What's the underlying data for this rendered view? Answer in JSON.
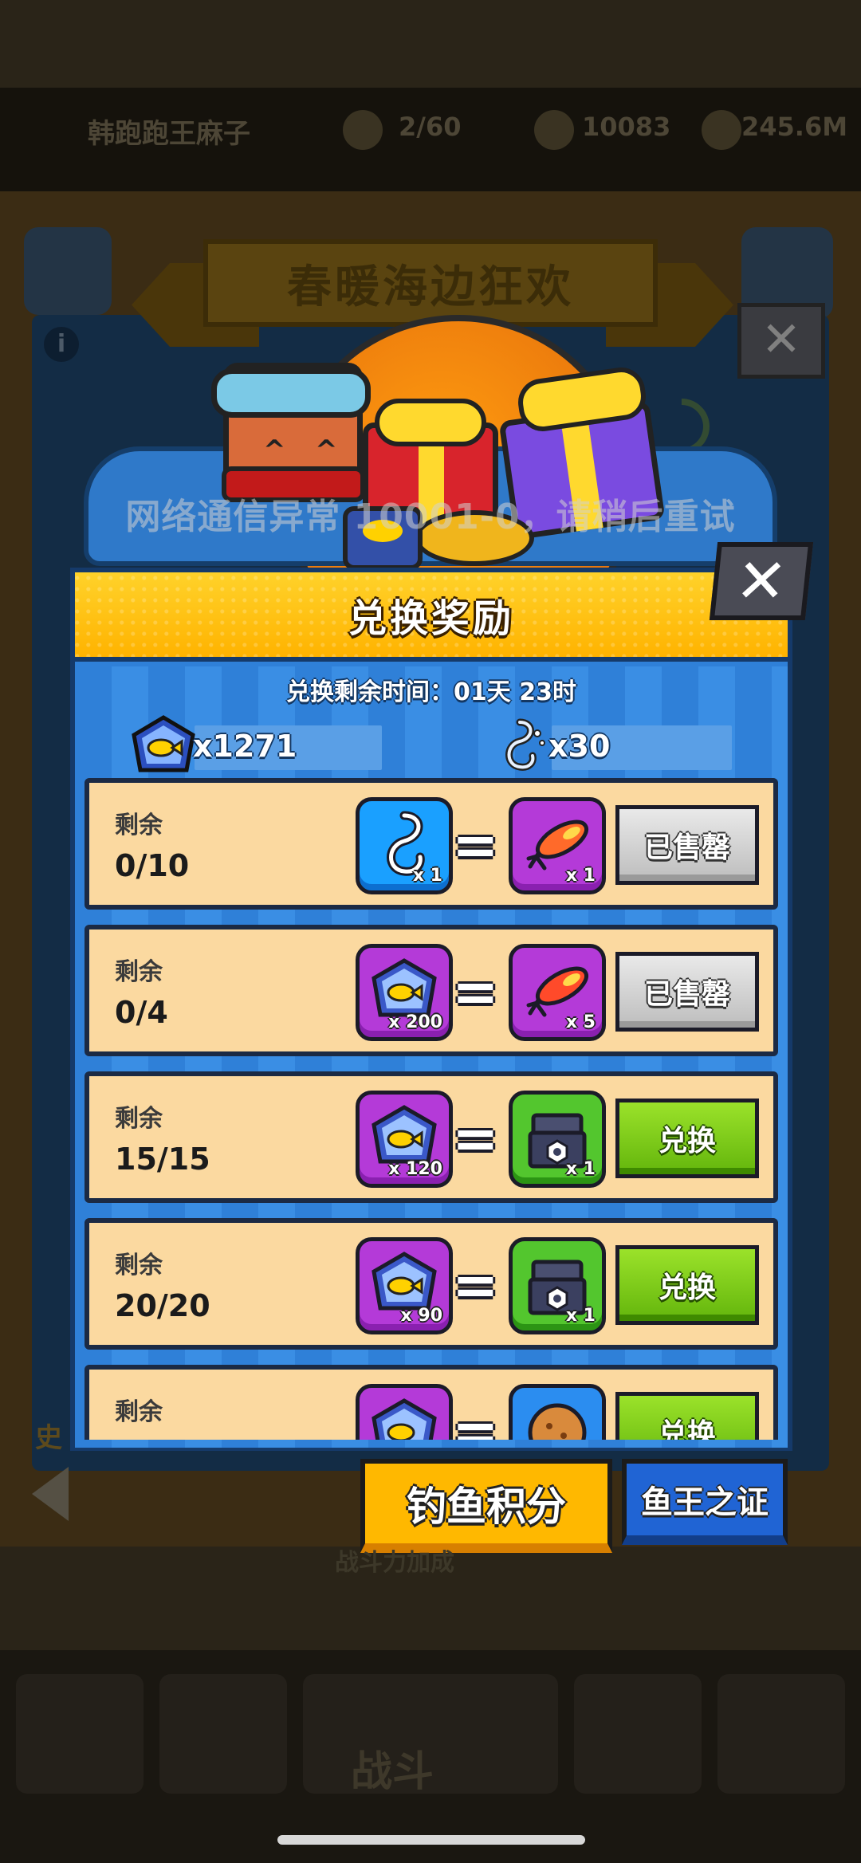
{
  "background": {
    "player_name": "韩跑跑王麻子",
    "stats": [
      "2/60",
      "10083",
      "245.6M"
    ],
    "side_text": "史",
    "under_tabs_text": "战斗力加成",
    "bottom_nav_battle": "战斗"
  },
  "event": {
    "title": "春暖海边狂欢",
    "close_glyph": "✕",
    "info_glyph": "i"
  },
  "toast": "网络通信异常 10001-0，请稍后重试",
  "modal": {
    "title": "兑换奖励",
    "close_glyph": "✕",
    "timer_label": "兑换剩余时间：01天 23时",
    "currencies": [
      {
        "icon": "fish-badge-icon",
        "value": "x1271"
      },
      {
        "icon": "fishing-hook-icon",
        "value": "x30"
      }
    ],
    "rows": [
      {
        "label": "剩余",
        "count": "0/10",
        "cost_icon": "fishing-hook-icon",
        "cost_tile": "blue",
        "cost_qty": "x 1",
        "reward_icon": "fishing-lure-icon",
        "reward_tile": "purple",
        "reward_qty": "x 1",
        "action": "已售罄",
        "sold_out": true
      },
      {
        "label": "剩余",
        "count": "0/4",
        "cost_icon": "fish-badge-icon",
        "cost_tile": "purple",
        "cost_qty": "x 200",
        "reward_icon": "fishing-lure-icon",
        "reward_tile": "purple",
        "reward_qty": "x 5",
        "action": "已售罄",
        "sold_out": true
      },
      {
        "label": "剩余",
        "count": "15/15",
        "cost_icon": "fish-badge-icon",
        "cost_tile": "purple",
        "cost_qty": "x 120",
        "reward_icon": "chest-icon",
        "reward_tile": "green",
        "reward_qty": "x 1",
        "action": "兑换",
        "sold_out": false
      },
      {
        "label": "剩余",
        "count": "20/20",
        "cost_icon": "fish-badge-icon",
        "cost_tile": "purple",
        "cost_qty": "x 90",
        "reward_icon": "chest-icon",
        "reward_tile": "green",
        "reward_qty": "x 1",
        "action": "兑换",
        "sold_out": false
      },
      {
        "label": "剩余",
        "count": "",
        "cost_icon": "fish-badge-icon",
        "cost_tile": "purple",
        "cost_qty": "",
        "reward_icon": "cookie-icon",
        "reward_tile": "orange",
        "reward_qty": "",
        "action": "兑换",
        "sold_out": false
      }
    ]
  },
  "tabs": {
    "points": "钓鱼积分",
    "badge": "鱼王之证"
  },
  "colors": {
    "modal_blue": "#2f80d8",
    "header_yellow": "#ffb300",
    "row_bg": "#fbd9a0",
    "action_green": "#63b50c",
    "sold_gray": "#bdbdbd"
  }
}
